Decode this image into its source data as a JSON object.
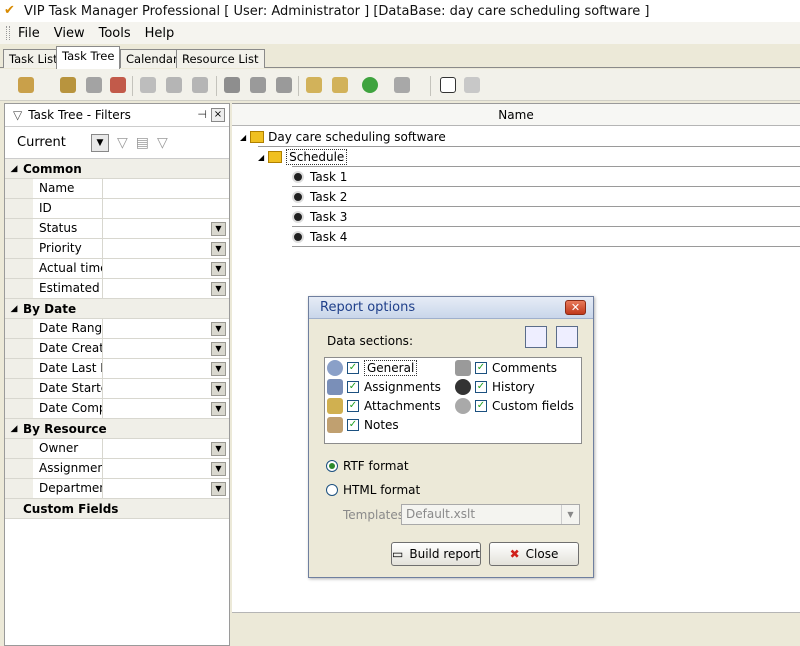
{
  "window": {
    "title": "VIP Task Manager Professional [ User: Administrator ] [DataBase: day care scheduling software ]"
  },
  "menu": [
    "File",
    "View",
    "Tools",
    "Help"
  ],
  "tabs": [
    "Task List",
    "Task Tree",
    "Calendar",
    "Resource List"
  ],
  "filter_panel": {
    "title": "Task Tree - Filters",
    "current_filter": "Current",
    "groups": [
      {
        "label": "Common",
        "items": [
          {
            "label": "Name",
            "dropdown": false
          },
          {
            "label": "ID",
            "dropdown": false
          },
          {
            "label": "Status",
            "dropdown": true
          },
          {
            "label": "Priority",
            "dropdown": true
          },
          {
            "label": "Actual time",
            "dropdown": true
          },
          {
            "label": "Estimated Ti",
            "dropdown": true
          }
        ]
      },
      {
        "label": "By Date",
        "items": [
          {
            "label": "Date Range",
            "dropdown": true
          },
          {
            "label": "Date Create",
            "dropdown": true
          },
          {
            "label": "Date Last M",
            "dropdown": true
          },
          {
            "label": "Date Startec",
            "dropdown": true
          },
          {
            "label": "Date Comple",
            "dropdown": true
          }
        ]
      },
      {
        "label": "By Resource",
        "items": [
          {
            "label": "Owner",
            "dropdown": true
          },
          {
            "label": "Assignment",
            "dropdown": true
          },
          {
            "label": "Department",
            "dropdown": true
          }
        ]
      }
    ],
    "custom_fields_label": "Custom Fields"
  },
  "tree": {
    "column_header": "Name",
    "root": "Day care scheduling software",
    "schedule": "Schedule",
    "tasks": [
      "Task 1",
      "Task 2",
      "Task 3",
      "Task 4"
    ]
  },
  "dialog": {
    "title": "Report options",
    "data_sections_label": "Data sections:",
    "sections_left": [
      "General",
      "Assignments",
      "Attachments",
      "Notes"
    ],
    "sections_right": [
      "Comments",
      "History",
      "Custom fields"
    ],
    "format_rtf": "RTF format",
    "format_html": "HTML format",
    "templates_label": "Templates",
    "template_value": "Default.xslt",
    "build_button": "Build report",
    "close_button": "Close"
  }
}
